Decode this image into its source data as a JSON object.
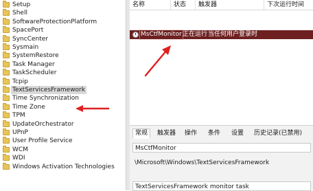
{
  "tree": {
    "items": [
      {
        "label": "Setup"
      },
      {
        "label": "Shell"
      },
      {
        "label": "SoftwareProtectionPlatform"
      },
      {
        "label": "SpacePort"
      },
      {
        "label": "SyncCenter"
      },
      {
        "label": "Sysmain"
      },
      {
        "label": "SystemRestore"
      },
      {
        "label": "Task Manager"
      },
      {
        "label": "TaskScheduler"
      },
      {
        "label": "Tcpip"
      },
      {
        "label": "TextServicesFramework",
        "selected": true
      },
      {
        "label": "Time Synchronization"
      },
      {
        "label": "Time Zone"
      },
      {
        "label": "TPM"
      },
      {
        "label": "UpdateOrchestrator"
      },
      {
        "label": "UPnP"
      },
      {
        "label": "User Profile Service"
      },
      {
        "label": "WCM"
      },
      {
        "label": "WDI"
      },
      {
        "label": "Windows Activation Technologies"
      }
    ]
  },
  "task_list": {
    "columns": [
      "名称",
      "状态",
      "触发器",
      "下次运行时间"
    ],
    "rows": [
      {
        "name": "MsCtfMonitor",
        "status": "正在运行",
        "trigger": "当任何用户登录时",
        "next_run": ""
      }
    ]
  },
  "details": {
    "tabs": [
      "常规",
      "触发器",
      "操作",
      "条件",
      "设置",
      "历史记录(已禁用)"
    ],
    "active_tab": "常规",
    "name_value": "MsCtfMonitor",
    "location_value": "\\Microsoft\\Windows\\TextServicesFramework",
    "description_value": "TextServicesFramework monitor task"
  },
  "colors": {
    "selected_row_bg": "#6e2020",
    "annotation_arrow": "#e02020"
  }
}
